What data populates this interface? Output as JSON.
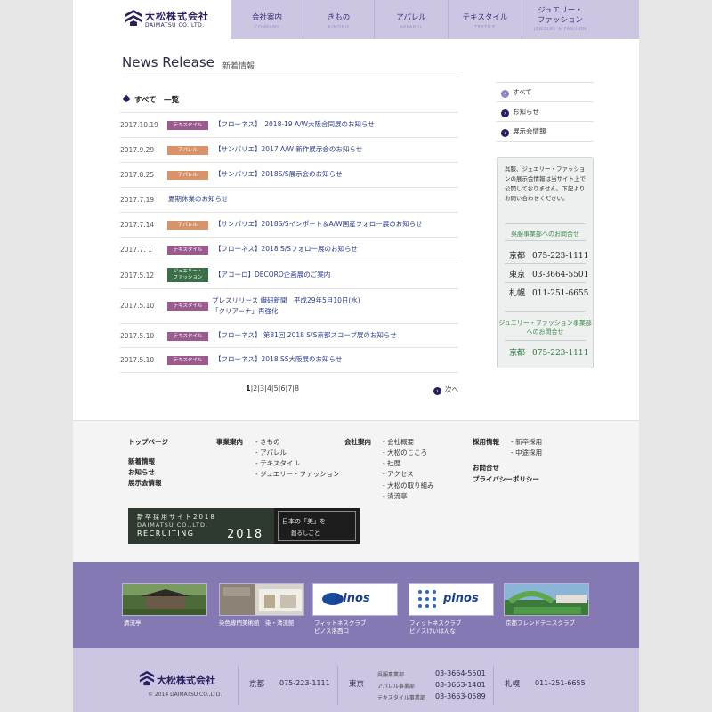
{
  "header": {
    "logo_text": "大松株式会社",
    "logo_sub": "DAIMATSU CO.,LTD.",
    "nav": [
      {
        "jp": "会社案内",
        "en": "COMPANY"
      },
      {
        "jp": "きもの",
        "en": "KIMONO"
      },
      {
        "jp": "アパレル",
        "en": "APPAREL"
      },
      {
        "jp": "テキスタイル",
        "en": "TEXTILE"
      },
      {
        "jp1": "ジュエリー・",
        "jp2": "ファッション",
        "en": "JEWELRY & FASHION"
      }
    ]
  },
  "main": {
    "title": "News Release",
    "title_sub": "新着情報",
    "list_heading": "すべて　一覧",
    "news": [
      {
        "date": "2017.10.19",
        "badge": "テキスタイル",
        "badge_color": "#9b5b8f",
        "title": "【フローネス】　2018-19 A/W大阪合同展のお知らせ"
      },
      {
        "date": "2017.9.29",
        "badge": "アパレル",
        "badge_color": "#d8936a",
        "title": "【サンパリエ】2017 A/W 新作展示会のお知らせ"
      },
      {
        "date": "2017.8.25",
        "badge": "アパレル",
        "badge_color": "#d8936a",
        "title": "【サンパリエ】2018S/S展示会のお知らせ"
      },
      {
        "date": "2017.7.19",
        "badge": "",
        "badge_color": "",
        "title": "夏期休業のお知らせ"
      },
      {
        "date": "2017.7.14",
        "badge": "アパレル",
        "badge_color": "#d8936a",
        "title": "【サンパリエ】2018S/Sインポート＆A/W国産フォロー展のお知らせ"
      },
      {
        "date": "2017.7. 1",
        "badge": "テキスタイル",
        "badge_color": "#9b5b8f",
        "title": "【フローネス】2018 S/Sフォロー展のお知らせ"
      },
      {
        "date": "2017.5.12",
        "badge1": "ジュエリー・",
        "badge2": "ファッション",
        "badge_color": "#3a7048",
        "title": "【アコーロ】DECORO企画展のご案内"
      },
      {
        "date": "2017.5.10",
        "badge": "テキスタイル",
        "badge_color": "#9b5b8f",
        "title1": "プレスリリース 繊研新聞　平成29年5月10日(水)",
        "title2": "「クリアーナ」再強化"
      },
      {
        "date": "2017.5.10",
        "badge": "テキスタイル",
        "badge_color": "#9b5b8f",
        "title": "【フローネス】 第81回 2018 S/S京都スコープ展のお知らせ"
      },
      {
        "date": "2017.5.10",
        "badge": "テキスタイル",
        "badge_color": "#9b5b8f",
        "title": "【フローネス】2018 SS大阪展のお知らせ"
      }
    ],
    "pager": {
      "current": "1",
      "rest": "|2|3|4|5|6|7|8",
      "next": "次へ"
    }
  },
  "sidebar": {
    "nav": [
      "すべて",
      "お知らせ",
      "展示会情報"
    ],
    "contact": {
      "intro": "呉服、ジュエリー・ファッションの展示会情報は当サイト上で公開しておりません。下記よりお問い合わせください。",
      "gofuku_heading": "呉服事業部へのお問合せ",
      "rows": [
        {
          "city": "京都",
          "tel": "075-223-1111"
        },
        {
          "city": "東京",
          "tel": "03-3664-5501"
        },
        {
          "city": "札幌",
          "tel": "011-251-6655"
        }
      ],
      "jewelry_heading": "ジュエリー・ファッション事業部へのお問合せ",
      "jewelry_row": {
        "city": "京都",
        "tel": "075-223-1111"
      }
    }
  },
  "footer": {
    "top_page": "トップページ",
    "links_left": [
      "新着情報",
      "お知らせ",
      "展示会情報"
    ],
    "business_label": "事業案内",
    "business": [
      "- きもの",
      "- アパレル",
      "- テキスタイル",
      "- ジュエリー・ファッション"
    ],
    "company_label": "会社案内",
    "company": [
      "- 会社概要",
      "- 大松のこころ",
      "- 社歴",
      "- アクセス",
      "- 大松の取り組み",
      "- 清流亭"
    ],
    "recruit_label": "採用情報",
    "recruit": [
      "- 新卒採用",
      "- 中途採用"
    ],
    "inquiry": "お問合せ",
    "privacy": "プライバシーポリシー",
    "banner": {
      "line1": "新卒採用サイト2018",
      "line2": "DAIMATSU CO.,LTD.",
      "line3": "RECRUITING",
      "year": "2018",
      "r1": "日本の「美」を",
      "r2": "創るしごと"
    },
    "links2": [
      {
        "label1": "清流亭",
        "label2": ""
      },
      {
        "label1": "染色専門美術館　染・清流館",
        "label2": ""
      },
      {
        "label1": "フィットネスクラブ",
        "label2": "ピノス洛西口",
        "logo": "pinos"
      },
      {
        "label1": "フィットネスクラブ",
        "label2": "ピノスけいはんな",
        "logo": "pinos"
      },
      {
        "label1": "京都フレンドテニスクラブ",
        "label2": ""
      }
    ],
    "bottom": {
      "logo_text": "大松株式会社",
      "copyright": "© 2014 DAIMATSU CO.,LTD.",
      "kyoto": "京都",
      "kyoto_tel": "075-223-1111",
      "tokyo": "東京",
      "tokyo_rows": [
        {
          "label": "呉服事業部",
          "tel": "03-3664-5501"
        },
        {
          "label": "アパレル事業部",
          "tel": "03-3663-1401"
        },
        {
          "label": "テキスタイル事業部",
          "tel": "03-3663-0589"
        }
      ],
      "sapporo": "札幌",
      "sapporo_tel": "011-251-6655"
    }
  }
}
